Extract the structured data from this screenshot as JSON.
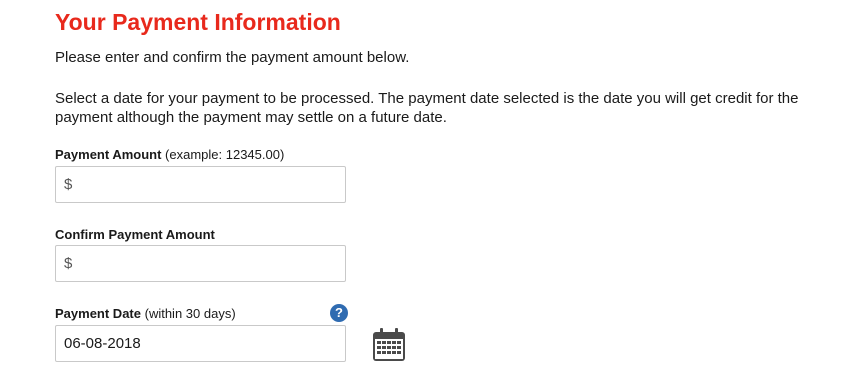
{
  "title": "Your Payment Information",
  "intro": "Please enter and confirm the payment amount below.",
  "instructions": "Select a date for your payment to be processed. The payment date selected is the date you will get credit for the payment although the payment may settle on a future date.",
  "payment_amount": {
    "label": "Payment Amount",
    "hint": "(example: 12345.00)",
    "prefix": "$",
    "value": ""
  },
  "confirm_amount": {
    "label": "Confirm Payment Amount",
    "prefix": "$",
    "value": ""
  },
  "payment_date": {
    "label": "Payment Date",
    "hint": "(within 30 days)",
    "value": "06-08-2018",
    "help_icon": "?",
    "calendar_icon": "calendar-icon"
  },
  "colors": {
    "title": "#e8291c",
    "help_icon": "#2f6bb1",
    "calendar_icon": "#4a4a4a"
  }
}
